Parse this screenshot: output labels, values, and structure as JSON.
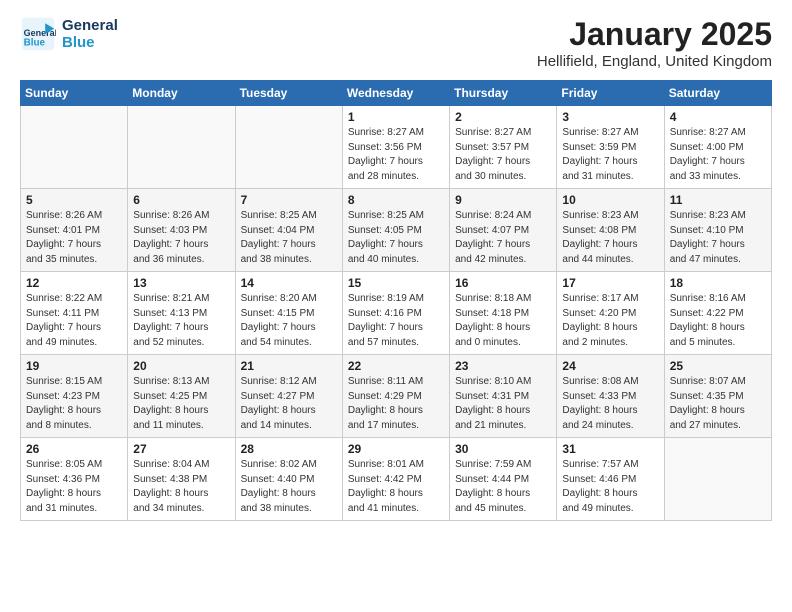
{
  "logo": {
    "line1": "General",
    "line2": "Blue"
  },
  "title": "January 2025",
  "location": "Hellifield, England, United Kingdom",
  "days_of_week": [
    "Sunday",
    "Monday",
    "Tuesday",
    "Wednesday",
    "Thursday",
    "Friday",
    "Saturday"
  ],
  "weeks": [
    [
      {
        "day": "",
        "info": ""
      },
      {
        "day": "",
        "info": ""
      },
      {
        "day": "",
        "info": ""
      },
      {
        "day": "1",
        "info": "Sunrise: 8:27 AM\nSunset: 3:56 PM\nDaylight: 7 hours\nand 28 minutes."
      },
      {
        "day": "2",
        "info": "Sunrise: 8:27 AM\nSunset: 3:57 PM\nDaylight: 7 hours\nand 30 minutes."
      },
      {
        "day": "3",
        "info": "Sunrise: 8:27 AM\nSunset: 3:59 PM\nDaylight: 7 hours\nand 31 minutes."
      },
      {
        "day": "4",
        "info": "Sunrise: 8:27 AM\nSunset: 4:00 PM\nDaylight: 7 hours\nand 33 minutes."
      }
    ],
    [
      {
        "day": "5",
        "info": "Sunrise: 8:26 AM\nSunset: 4:01 PM\nDaylight: 7 hours\nand 35 minutes."
      },
      {
        "day": "6",
        "info": "Sunrise: 8:26 AM\nSunset: 4:03 PM\nDaylight: 7 hours\nand 36 minutes."
      },
      {
        "day": "7",
        "info": "Sunrise: 8:25 AM\nSunset: 4:04 PM\nDaylight: 7 hours\nand 38 minutes."
      },
      {
        "day": "8",
        "info": "Sunrise: 8:25 AM\nSunset: 4:05 PM\nDaylight: 7 hours\nand 40 minutes."
      },
      {
        "day": "9",
        "info": "Sunrise: 8:24 AM\nSunset: 4:07 PM\nDaylight: 7 hours\nand 42 minutes."
      },
      {
        "day": "10",
        "info": "Sunrise: 8:23 AM\nSunset: 4:08 PM\nDaylight: 7 hours\nand 44 minutes."
      },
      {
        "day": "11",
        "info": "Sunrise: 8:23 AM\nSunset: 4:10 PM\nDaylight: 7 hours\nand 47 minutes."
      }
    ],
    [
      {
        "day": "12",
        "info": "Sunrise: 8:22 AM\nSunset: 4:11 PM\nDaylight: 7 hours\nand 49 minutes."
      },
      {
        "day": "13",
        "info": "Sunrise: 8:21 AM\nSunset: 4:13 PM\nDaylight: 7 hours\nand 52 minutes."
      },
      {
        "day": "14",
        "info": "Sunrise: 8:20 AM\nSunset: 4:15 PM\nDaylight: 7 hours\nand 54 minutes."
      },
      {
        "day": "15",
        "info": "Sunrise: 8:19 AM\nSunset: 4:16 PM\nDaylight: 7 hours\nand 57 minutes."
      },
      {
        "day": "16",
        "info": "Sunrise: 8:18 AM\nSunset: 4:18 PM\nDaylight: 8 hours\nand 0 minutes."
      },
      {
        "day": "17",
        "info": "Sunrise: 8:17 AM\nSunset: 4:20 PM\nDaylight: 8 hours\nand 2 minutes."
      },
      {
        "day": "18",
        "info": "Sunrise: 8:16 AM\nSunset: 4:22 PM\nDaylight: 8 hours\nand 5 minutes."
      }
    ],
    [
      {
        "day": "19",
        "info": "Sunrise: 8:15 AM\nSunset: 4:23 PM\nDaylight: 8 hours\nand 8 minutes."
      },
      {
        "day": "20",
        "info": "Sunrise: 8:13 AM\nSunset: 4:25 PM\nDaylight: 8 hours\nand 11 minutes."
      },
      {
        "day": "21",
        "info": "Sunrise: 8:12 AM\nSunset: 4:27 PM\nDaylight: 8 hours\nand 14 minutes."
      },
      {
        "day": "22",
        "info": "Sunrise: 8:11 AM\nSunset: 4:29 PM\nDaylight: 8 hours\nand 17 minutes."
      },
      {
        "day": "23",
        "info": "Sunrise: 8:10 AM\nSunset: 4:31 PM\nDaylight: 8 hours\nand 21 minutes."
      },
      {
        "day": "24",
        "info": "Sunrise: 8:08 AM\nSunset: 4:33 PM\nDaylight: 8 hours\nand 24 minutes."
      },
      {
        "day": "25",
        "info": "Sunrise: 8:07 AM\nSunset: 4:35 PM\nDaylight: 8 hours\nand 27 minutes."
      }
    ],
    [
      {
        "day": "26",
        "info": "Sunrise: 8:05 AM\nSunset: 4:36 PM\nDaylight: 8 hours\nand 31 minutes."
      },
      {
        "day": "27",
        "info": "Sunrise: 8:04 AM\nSunset: 4:38 PM\nDaylight: 8 hours\nand 34 minutes."
      },
      {
        "day": "28",
        "info": "Sunrise: 8:02 AM\nSunset: 4:40 PM\nDaylight: 8 hours\nand 38 minutes."
      },
      {
        "day": "29",
        "info": "Sunrise: 8:01 AM\nSunset: 4:42 PM\nDaylight: 8 hours\nand 41 minutes."
      },
      {
        "day": "30",
        "info": "Sunrise: 7:59 AM\nSunset: 4:44 PM\nDaylight: 8 hours\nand 45 minutes."
      },
      {
        "day": "31",
        "info": "Sunrise: 7:57 AM\nSunset: 4:46 PM\nDaylight: 8 hours\nand 49 minutes."
      },
      {
        "day": "",
        "info": ""
      }
    ]
  ]
}
